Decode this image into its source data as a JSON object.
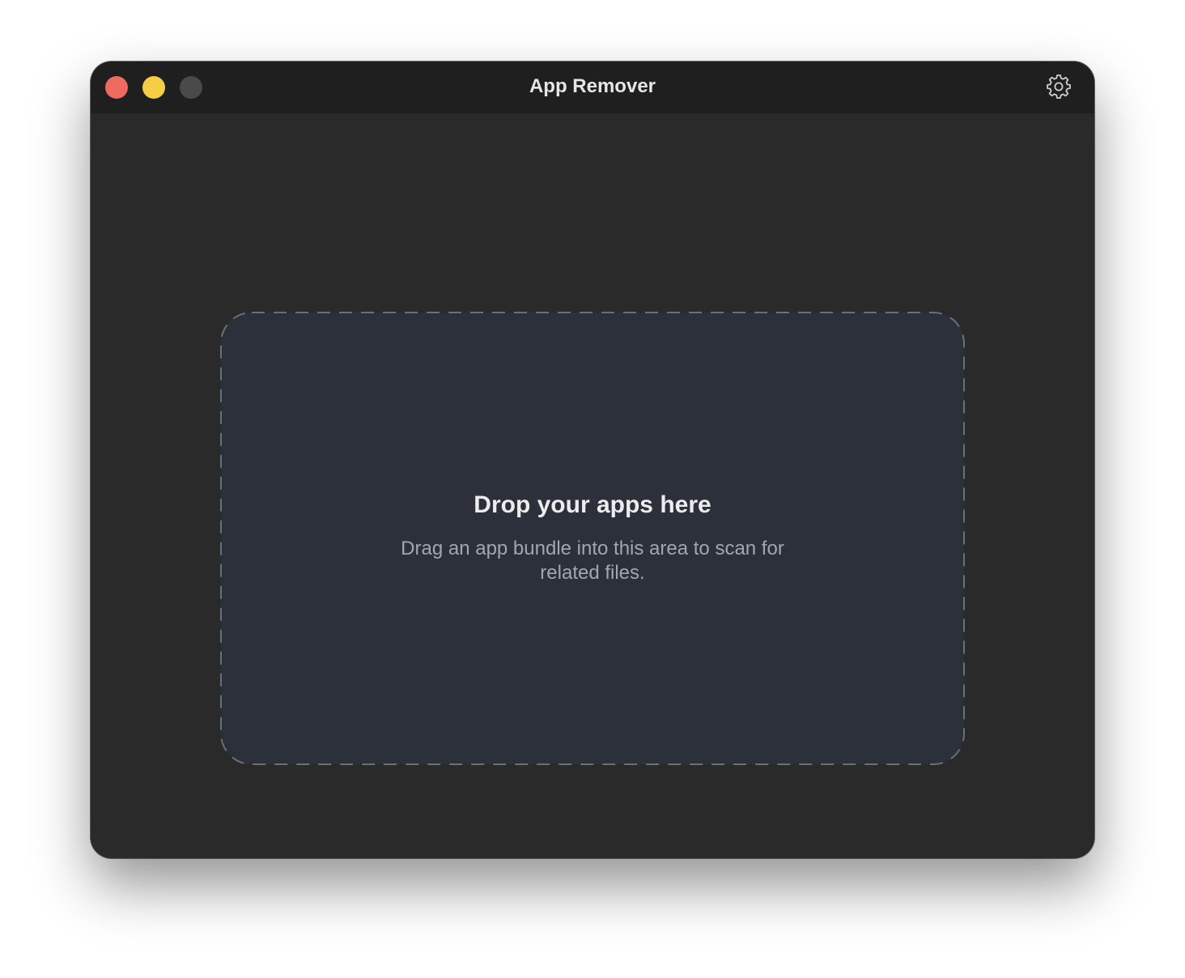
{
  "window": {
    "title": "App Remover",
    "controls": {
      "close": {
        "icon": "close-light-icon",
        "color": "#ee6a5f"
      },
      "minimize": {
        "icon": "minimize-light-icon",
        "color": "#f5cd47"
      },
      "zoom": {
        "icon": "zoom-light-icon",
        "color": "#4a4a4a"
      }
    },
    "settings_icon": "gear-icon"
  },
  "dropzone": {
    "title": "Drop your apps here",
    "subtitle": "Drag an app bundle into this area to scan for related files."
  },
  "colors": {
    "titlebar": "#1f1f1f",
    "background": "#2a2a2a",
    "dropzone_fill": "#2b303b",
    "dropzone_border": "#6b6f76"
  }
}
